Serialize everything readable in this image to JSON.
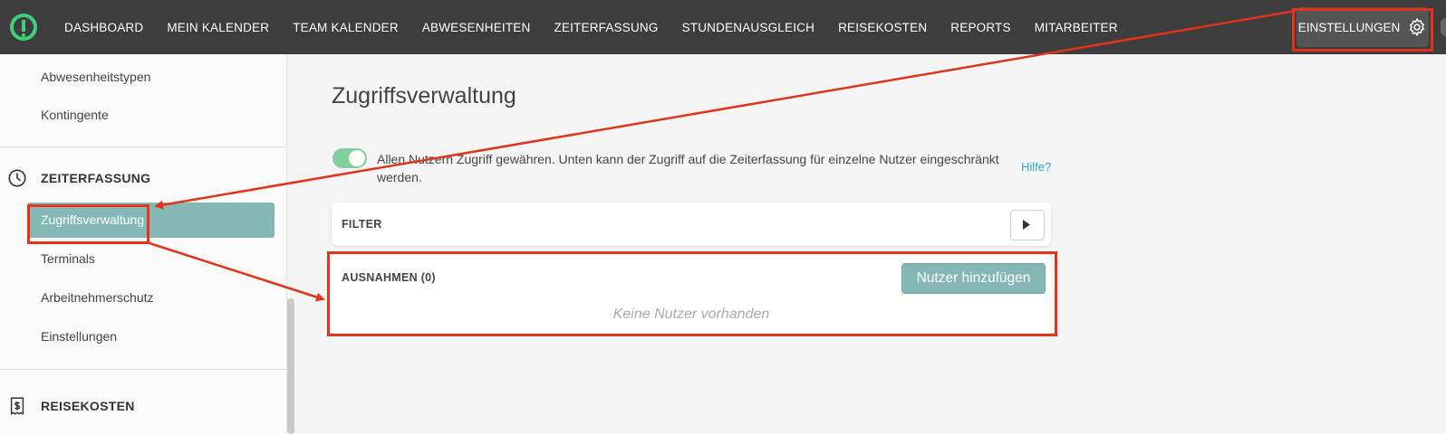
{
  "nav": {
    "items": [
      "DASHBOARD",
      "MEIN KALENDER",
      "TEAM KALENDER",
      "ABWESENHEITEN",
      "ZEITERFASSUNG",
      "STUNDENAUSGLEICH",
      "REISEKOSTEN",
      "REPORTS",
      "MITARBEITER"
    ],
    "settings_label": "EINSTELLUNGEN"
  },
  "sidebar": {
    "items_top": [
      "Abwesenheitstypen",
      "Kontingente"
    ],
    "section_zeiterfassung": "ZEITERFASSUNG",
    "active_item": "Zugriffsverwaltung",
    "items_zeiterfassung": [
      "Terminals",
      "Arbeitnehmerschutz",
      "Einstellungen"
    ],
    "section_reisekosten": "REISEKOSTEN"
  },
  "main": {
    "title": "Zugriffsverwaltung",
    "toggle_on": true,
    "access_text": "Allen Nutzern Zugriff gewähren. Unten kann der Zugriff auf die Zeiterfassung für einzelne Nutzer eingeschränkt werden.",
    "help_link": "Hilfe?",
    "filter_label": "FILTER",
    "exceptions_label": "AUSNAHMEN (0)",
    "add_user_button": "Nutzer hinzufügen",
    "empty_text": "Keine Nutzer vorhanden"
  },
  "colors": {
    "topbar": "#3d3d3d",
    "accent_teal": "#85b7b7",
    "toggle_green": "#7fcf9f",
    "annotation_red": "#e3341a",
    "link_blue": "#2aa7c9"
  },
  "icons": [
    "app-logo-icon",
    "gear-icon",
    "clock-icon",
    "receipt-icon",
    "play-icon"
  ]
}
